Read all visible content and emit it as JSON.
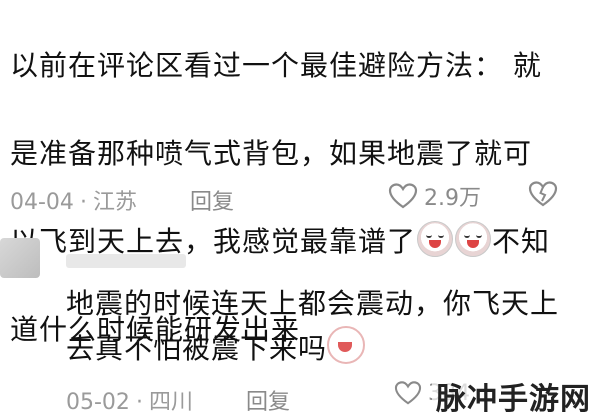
{
  "comment1": {
    "lines": [
      "以前在评论区看过一个最佳避险方法：  就",
      "是准备那种喷气式背包，如果地震了就可",
      "以飞到天上去，我感觉最靠谱了",
      "道什么时候能研发出来"
    ],
    "line3_tail": "不知",
    "date": "04-04",
    "location": "江苏",
    "reply_label": "回复",
    "like_count": "2.9万"
  },
  "comment2": {
    "lines": [
      "地震的时候连天上都会震动，你飞天上",
      "去真不怕被震下来吗"
    ],
    "date": "05-02",
    "location": "四川",
    "reply_label": "回复",
    "like_count": "384"
  },
  "watermark": "脉冲手游网",
  "colors": {
    "meta": "#9a9a9a",
    "text": "#111111"
  }
}
